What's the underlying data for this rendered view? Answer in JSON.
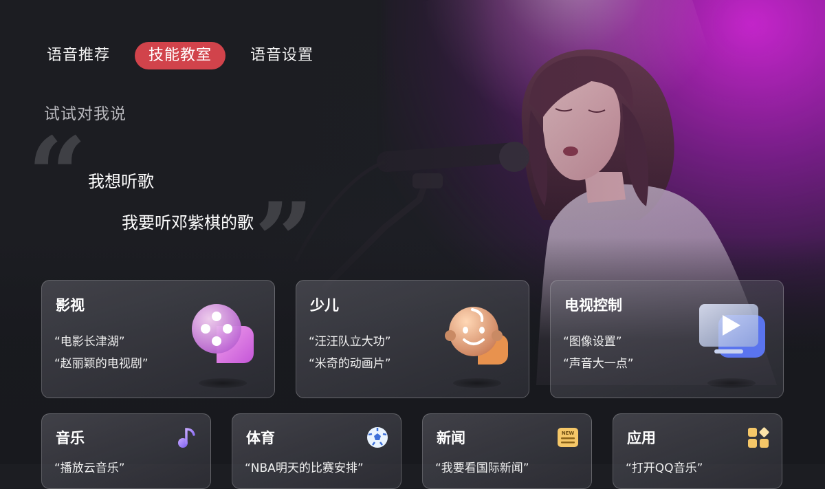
{
  "tabs": [
    {
      "label": "语音推荐",
      "active": false
    },
    {
      "label": "技能教室",
      "active": true
    },
    {
      "label": "语音设置",
      "active": false
    }
  ],
  "prompt": {
    "title": "试试对我说",
    "examples": [
      "我想听歌",
      "我要听邓紫棋的歌"
    ]
  },
  "cards": [
    {
      "title": "影视",
      "lines": [
        "“电影长津湖”",
        "“赵丽颖的电视剧”"
      ],
      "icon": "film-reel-icon",
      "color": "#e07be0"
    },
    {
      "title": "少儿",
      "lines": [
        "“汪汪队立大功”",
        "“米奇的动画片”"
      ],
      "icon": "child-face-icon",
      "color": "#f0a060"
    },
    {
      "title": "电视控制",
      "lines": [
        "“图像设置”",
        "“声音大一点”"
      ],
      "icon": "tv-play-icon",
      "color": "#6d8cff"
    }
  ],
  "small_cards": [
    {
      "title": "音乐",
      "line": "“播放云音乐”",
      "icon": "music-note-icon"
    },
    {
      "title": "体育",
      "line": "“NBA明天的比赛安排”",
      "icon": "soccer-ball-icon"
    },
    {
      "title": "新闻",
      "line": "“我要看国际新闻”",
      "icon": "news-icon",
      "badge": "NEW"
    },
    {
      "title": "应用",
      "line": "“打开QQ音乐”",
      "icon": "apps-grid-icon"
    }
  ],
  "colors": {
    "accent": "#d1434b",
    "stage_light": "#d626dc"
  }
}
